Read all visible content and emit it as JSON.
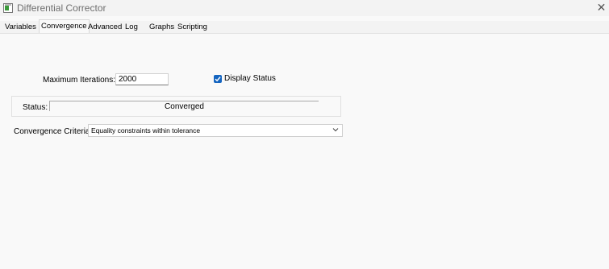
{
  "window": {
    "title": "Differential Corrector"
  },
  "tabs": [
    {
      "label": "Variables"
    },
    {
      "label": "Convergence"
    },
    {
      "label": "Advanced"
    },
    {
      "label": "Log"
    },
    {
      "label": "Graphs"
    },
    {
      "label": "Scripting"
    }
  ],
  "active_tab": "Convergence",
  "max_iterations": {
    "label": "Maximum Iterations:",
    "value": "2000"
  },
  "display_status": {
    "label": "Display Status",
    "checked": true
  },
  "status": {
    "label": "Status:",
    "value": "Converged"
  },
  "convergence_criteria": {
    "label": "Convergence Criteria:",
    "selected": "Equality constraints within tolerance"
  },
  "colors": {
    "accent": "#1565c0"
  }
}
